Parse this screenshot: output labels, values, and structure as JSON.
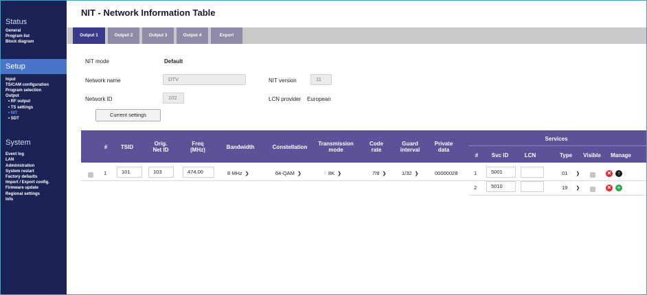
{
  "sidebar": {
    "status_title": "Status",
    "status_items": [
      "General",
      "Program list",
      "Block diagram"
    ],
    "setup_title": "Setup",
    "setup_items": [
      "Input",
      "TS/CAM configuration",
      "Program selection",
      "Output"
    ],
    "output_sub_items": [
      "• RF output",
      "• TS settings",
      "• NIT",
      "• SDT"
    ],
    "system_title": "System",
    "system_items": [
      "Event log",
      "LAN",
      "Administration",
      "System restart",
      "Factory defaults",
      "Import / Export config.",
      "Firmware update",
      "Regional settings",
      "Info"
    ]
  },
  "page": {
    "title": "NIT - Network Information Table"
  },
  "tabs": [
    "Output 1",
    "Output 2",
    "Output 3",
    "Output 4",
    "Export"
  ],
  "form": {
    "nit_mode_label": "NIT mode",
    "nit_mode_value": "Default",
    "network_name_label": "Network name",
    "network_name_value": "DTV",
    "network_id_label": "Network ID",
    "network_id_value": "102",
    "nit_version_label": "NIT version",
    "nit_version_value": "11",
    "lcn_provider_label": "LCN provider",
    "lcn_provider_value": "European",
    "current_settings_button": "Current settings"
  },
  "table": {
    "headers": {
      "num": "#",
      "tsid": "TSID",
      "orig_net_id": "Orig.\nNet ID",
      "freq": "Freq\n(MHz)",
      "bandwidth": "Bandwidth",
      "constellation": "Constellation",
      "transmission_mode": "Transmission\nmode",
      "code_rate": "Code\nrate",
      "guard_interval": "Guard\ninterval",
      "private_data": "Private\ndata",
      "services": "Services",
      "svc_num": "#",
      "svc_id": "Svc ID",
      "lcn": "LCN",
      "type": "Type",
      "visible": "Visible",
      "manage": "Manage"
    },
    "row": {
      "num": "1",
      "tsid": "101",
      "orig_net_id": "103",
      "freq": "474.00",
      "bandwidth": "8 MHz",
      "constellation": "64-QAM",
      "transmission_mode": "8K",
      "code_rate": "7/8",
      "guard_interval": "1/32",
      "private_data": "00000028"
    },
    "services": [
      {
        "num": "1",
        "svc_id": "5001",
        "lcn": "",
        "type": "01"
      },
      {
        "num": "2",
        "svc_id": "5010",
        "lcn": "",
        "type": "19"
      }
    ]
  },
  "icons": {
    "remove": "remove-icon",
    "up": "move-up-icon",
    "add": "add-icon",
    "colors": {
      "remove": "#e0262b",
      "up": "#1a1a1a",
      "add": "#2aa84a"
    }
  },
  "colors": {
    "sidebar_bg": "#1b2255",
    "setup_active": "#4a74c9",
    "header_bg": "#5b529a",
    "tab_active": "#3a3a8c"
  }
}
